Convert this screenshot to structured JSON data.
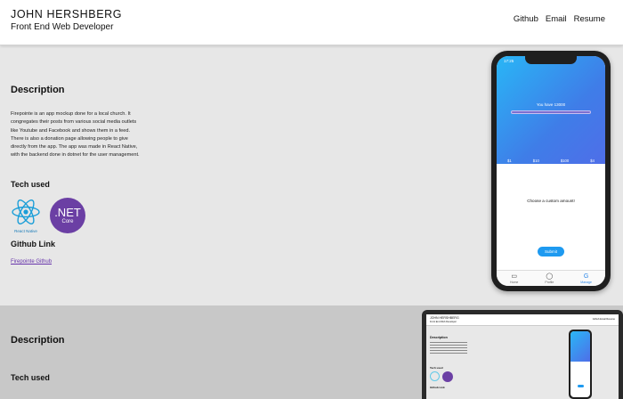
{
  "header": {
    "name": "JOHN HERSHBERG",
    "role": "Front End Web Developer",
    "nav": [
      "Github",
      "Email",
      "Resume"
    ]
  },
  "project1": {
    "description_heading": "Description",
    "description": "Firepointe is an app mockup done for a local church. It congregates their posts from various social media outlets like Youtube and Facebook and shows them in a feed. There is also a donation page allowing people to give directly from the app. The app was made in React Native, with the backend done in dotnet for the user management.",
    "tech_heading": "Tech used",
    "tech": {
      "react_label": "React Native",
      "net_line1": ".NET",
      "net_line2": "Core",
      "react_icon": "react-icon",
      "net_icon": "dotnet-core-icon"
    },
    "github_heading": "Github Link",
    "github_link": "Firepointe Github"
  },
  "phone": {
    "time": "17:25",
    "balance_text": "You have 13000",
    "amounts": [
      "$1",
      "$10",
      "$100",
      "$4"
    ],
    "custom_text": "Choose a custom amount!",
    "submit": "Submit",
    "tabs": [
      {
        "label": "Home",
        "icon": "home-icon"
      },
      {
        "label": "Profile",
        "icon": "user-icon"
      },
      {
        "label": "Manage",
        "icon": "g-icon"
      }
    ]
  },
  "project2": {
    "description_heading": "Description",
    "tech_heading": "Tech used",
    "mini": {
      "name": "JOHN HERSHBERG",
      "role": "Front End Web Developer",
      "nav": "Github  Email  Resume",
      "desc": "Description",
      "tech": "Tech used",
      "github": "Github Link"
    }
  },
  "colors": {
    "accent_blue": "#29b6f6",
    "net_purple": "#6b3fa4",
    "link_purple": "#6633aa"
  }
}
